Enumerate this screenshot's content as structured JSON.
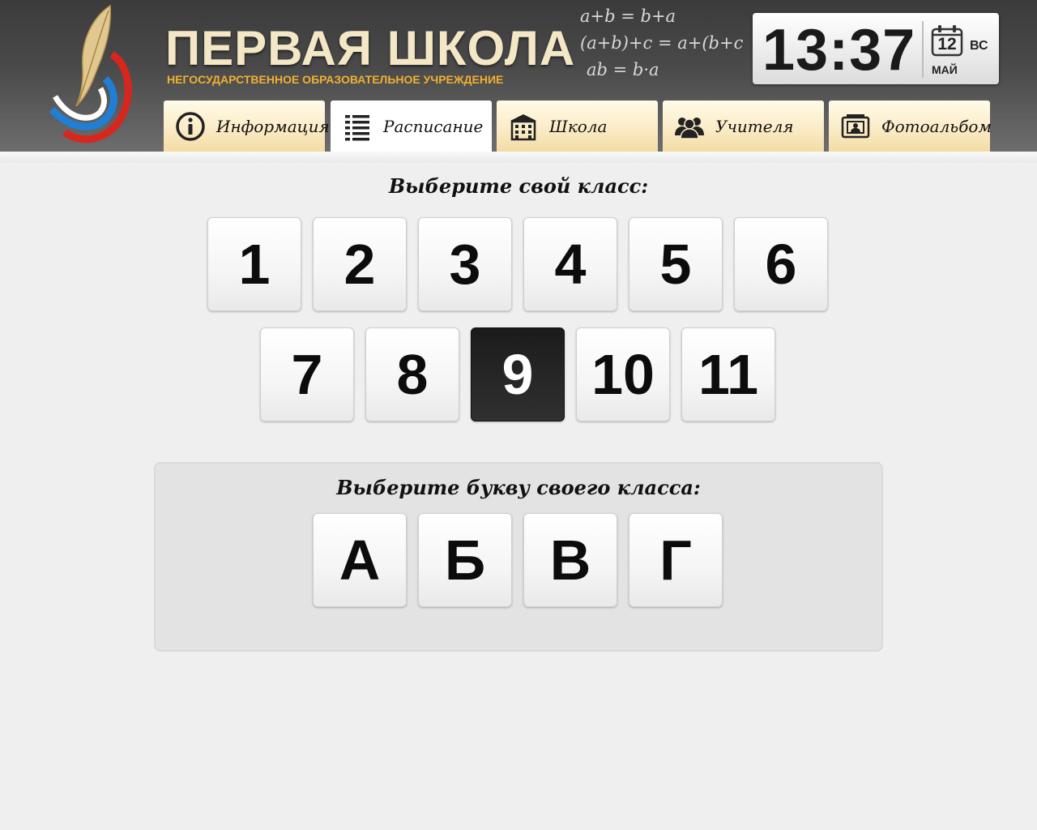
{
  "header": {
    "school_name": "ПЕРВАЯ ШКОЛА",
    "school_subtitle": "НЕГОСУДАРСТВЕННОЕ ОБРАЗОВАТЕЛЬНОЕ УЧРЕЖДЕНИЕ",
    "formulas": [
      "a+b = b+a",
      "(a+b)+c = a+(b+c",
      "ab = b·a"
    ],
    "clock": {
      "time": "13:37",
      "day": "12",
      "weekday": "ВС",
      "month": "МАЙ"
    }
  },
  "tabs": [
    {
      "label": "Информация",
      "icon": "info-icon",
      "active": false
    },
    {
      "label": "Расписание",
      "icon": "list-icon",
      "active": true
    },
    {
      "label": "Школа",
      "icon": "building-icon",
      "active": false
    },
    {
      "label": "Учителя",
      "icon": "people-icon",
      "active": false
    },
    {
      "label": "Фотоальбом",
      "icon": "photo-album-icon",
      "active": false
    }
  ],
  "main": {
    "class_prompt": "Выберите свой класс:",
    "classes_row1": [
      "1",
      "2",
      "3",
      "4",
      "5",
      "6"
    ],
    "classes_row2": [
      "7",
      "8",
      "9",
      "10",
      "11"
    ],
    "selected_class": "9",
    "letter_prompt": "Выберите букву своего класса:",
    "letters": [
      "А",
      "Б",
      "В",
      "Г"
    ]
  },
  "colors": {
    "header_dark": "#3b3b3b",
    "title_cream": "#f4e7c6",
    "subtitle_orange": "#f0b030",
    "tab_cream": "#fbecc7",
    "selected_button": "#1b1b1b",
    "page_background": "#efefef"
  }
}
